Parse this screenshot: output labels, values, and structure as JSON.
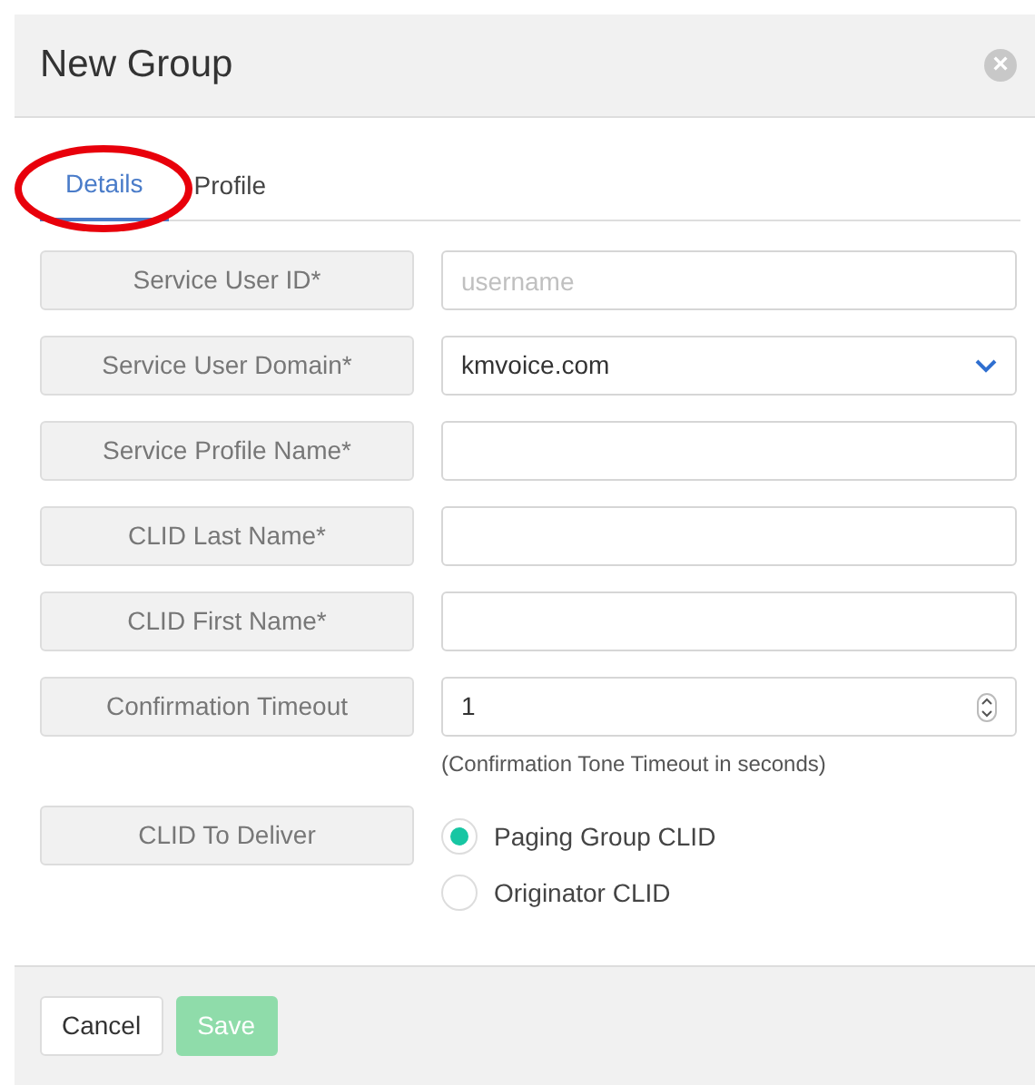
{
  "dialog": {
    "title": "New Group",
    "close_symbol": "×"
  },
  "tabs": [
    {
      "label": "Details",
      "selected": true
    },
    {
      "label": "Profile",
      "selected": false
    }
  ],
  "callout": {
    "kind": "ellipse",
    "color": "#e8000b"
  },
  "fields": [
    {
      "kind": "text",
      "label": "Service User ID*",
      "placeholder": "username"
    },
    {
      "kind": "select",
      "label": "Service User Domain*",
      "value": "kmvoice.com"
    },
    {
      "kind": "text",
      "label": "Service Profile Name*"
    },
    {
      "kind": "text",
      "label": "CLID Last Name*"
    },
    {
      "kind": "text",
      "label": "CLID First Name*"
    },
    {
      "kind": "number",
      "label": "Confirmation Timeout",
      "value": "1",
      "help": "(Confirmation Tone Timeout in seconds)"
    },
    {
      "kind": "radio",
      "label": "CLID To Deliver",
      "options": [
        {
          "label": "Paging Group CLID",
          "selected": true
        },
        {
          "label": "Originator CLID",
          "selected": false
        }
      ]
    }
  ],
  "buttons": [
    {
      "label": "Cancel",
      "kind": "default",
      "disabled": false
    },
    {
      "label": "Save",
      "kind": "primary",
      "disabled": true
    }
  ]
}
